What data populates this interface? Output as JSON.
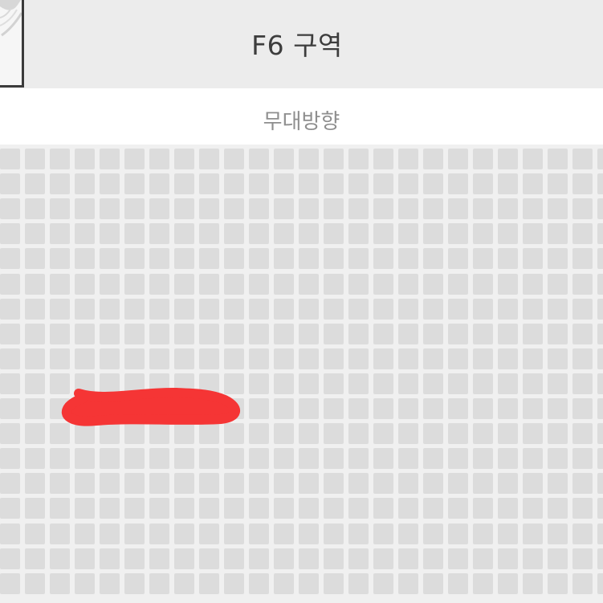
{
  "header": {
    "section_title": "F6 구역",
    "background_color": "#ececec"
  },
  "stage": {
    "label": "무대방향"
  },
  "seat_map": {
    "rows": 18,
    "columns": 25,
    "seat_color": "#dcdcdc",
    "background_color": "#f0f0f0"
  },
  "scribble": {
    "color": "#f53535",
    "icon": "redaction-scribble"
  }
}
